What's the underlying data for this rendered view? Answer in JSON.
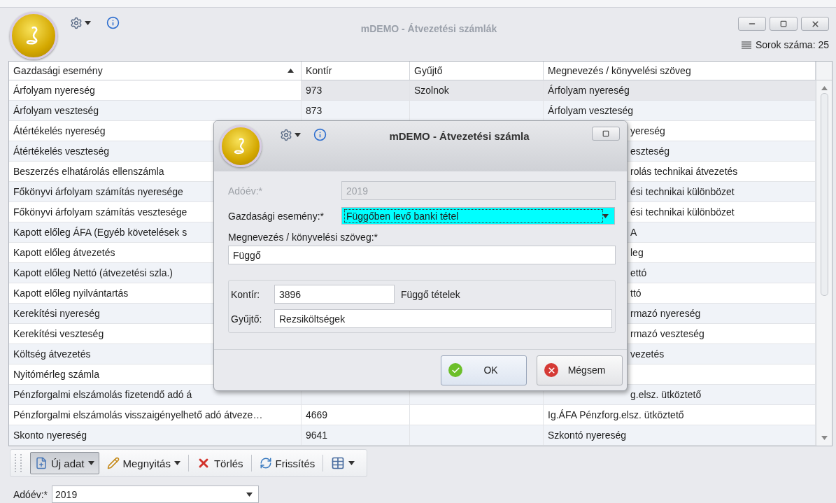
{
  "window": {
    "title": "mDEMO - Átvezetési számlák"
  },
  "row_count": "Sorok száma: 25",
  "table": {
    "columns": [
      {
        "label": "Gazdasági esemény",
        "sorted": true
      },
      {
        "label": "Kontír",
        "sorted": false
      },
      {
        "label": "Gyűjtő",
        "sorted": false
      },
      {
        "label": "Megnevezés / könyvelési szöveg",
        "sorted": false
      }
    ],
    "rows": [
      {
        "selected": true,
        "cells": [
          "Árfolyam nyereség",
          "973",
          "Szolnok",
          "Árfolyam nyereség"
        ]
      },
      {
        "selected": false,
        "cells": [
          "Árfolyam veszteség",
          "873",
          "",
          "Árfolyam veszteség"
        ]
      },
      {
        "selected": false,
        "cells": [
          "Átértékelés nyereség",
          "",
          "",
          "yereség"
        ]
      },
      {
        "selected": false,
        "cells": [
          "Átértékelés veszteség",
          "",
          "",
          "eszteség"
        ]
      },
      {
        "selected": false,
        "cells": [
          "Beszerzés elhatárolás ellenszámla",
          "",
          "",
          "rolás technikai átvezetés"
        ]
      },
      {
        "selected": false,
        "cells": [
          "Főkönyvi árfolyam számítás nyeresége",
          "",
          "",
          "ési technikai különbözet"
        ]
      },
      {
        "selected": false,
        "cells": [
          "Főkönyvi árfolyam számítás vesztesége",
          "",
          "",
          "ési technikai különbözet"
        ]
      },
      {
        "selected": false,
        "cells": [
          "Kapott előleg ÁFA (Egyéb követelések s",
          "",
          "",
          "A"
        ]
      },
      {
        "selected": false,
        "cells": [
          "Kapott előleg átvezetés",
          "",
          "",
          "leg"
        ]
      },
      {
        "selected": false,
        "cells": [
          "Kapott előleg Nettó (átvezetési szla.)",
          "",
          "",
          "ettó"
        ]
      },
      {
        "selected": false,
        "cells": [
          "Kapott előleg nyilvántartás",
          "",
          "",
          "ttó"
        ]
      },
      {
        "selected": false,
        "cells": [
          "Kerekítési nyereség",
          "",
          "",
          "rmazó nyereség"
        ]
      },
      {
        "selected": false,
        "cells": [
          "Kerekítési veszteség",
          "",
          "",
          "rmazó veszteség"
        ]
      },
      {
        "selected": false,
        "cells": [
          "Költség átvezetés",
          "",
          "",
          "vezetés"
        ]
      },
      {
        "selected": false,
        "cells": [
          "Nyitómérleg számla",
          "",
          "",
          ""
        ]
      },
      {
        "selected": false,
        "cells": [
          "Pénzforgalmi elszámolás fizetendő adó á",
          "",
          "",
          "g.elsz. ütköztető"
        ]
      },
      {
        "selected": false,
        "cells": [
          "Pénzforgalmi elszámolás visszaigényelhető adó átveze…",
          "4669",
          "",
          "Ig.ÁFA Pénzforg.elsz. ütköztető"
        ]
      },
      {
        "selected": false,
        "cells": [
          "Skonto nyereség",
          "9641",
          "",
          "Szkontó nyereség"
        ]
      }
    ]
  },
  "toolbar": {
    "items": [
      {
        "kind": "split",
        "label": "Új adat",
        "pressed": true
      },
      {
        "kind": "dropdown",
        "label": "Megnyitás",
        "pressed": false
      },
      {
        "kind": "button",
        "label": "Törlés",
        "pressed": false
      },
      {
        "kind": "button",
        "label": "Frissítés",
        "pressed": false
      },
      {
        "kind": "icon-dropdown",
        "pressed": false
      }
    ]
  },
  "filter": {
    "label": "Adóév:*",
    "value": "2019"
  },
  "dialog": {
    "title": "mDEMO - Átvezetési számla",
    "fields": [
      {
        "kind": "text",
        "label": "Adóév:*",
        "value": "2019",
        "disabled": true,
        "focused": false
      },
      {
        "kind": "combo",
        "label": "Gazdasági esemény:*",
        "value": "Függőben levő banki tétel",
        "disabled": false,
        "focused": true
      },
      {
        "kind": "stacked",
        "label": "Megnevezés / könyvelési szöveg:*",
        "value": "Függő",
        "disabled": false,
        "focused": false
      }
    ],
    "group": {
      "kontir": {
        "label": "Kontír:",
        "value": "3896",
        "description": "Függő tételek"
      },
      "gyujto": {
        "label": "Gyűjtő:",
        "value": "Rezsiköltségek"
      }
    },
    "buttons": [
      {
        "kind": "ok",
        "label": "OK",
        "default": true
      },
      {
        "kind": "cancel",
        "label": "Mégsem",
        "default": false
      }
    ]
  }
}
